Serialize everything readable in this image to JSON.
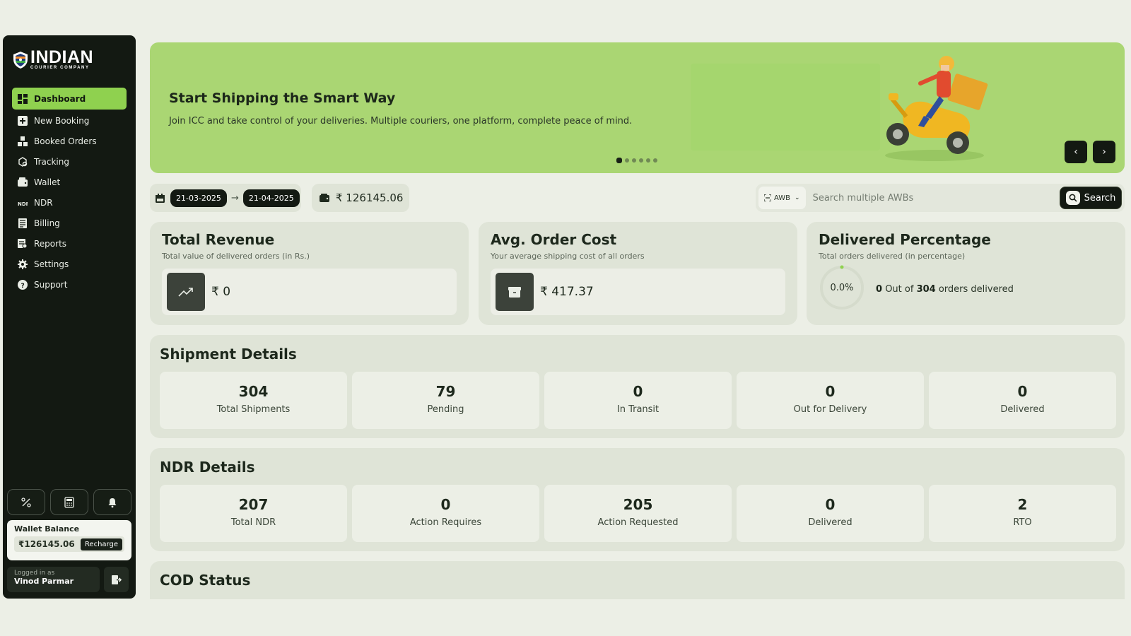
{
  "brand": {
    "name": "INDIAN",
    "tagline": "COURIER COMPANY"
  },
  "sidebar": {
    "items": [
      {
        "label": "Dashboard",
        "icon": "dashboard-icon",
        "active": true
      },
      {
        "label": "New Booking",
        "icon": "plus-square-icon"
      },
      {
        "label": "Booked Orders",
        "icon": "boxes-icon"
      },
      {
        "label": "Tracking",
        "icon": "tracking-icon"
      },
      {
        "label": "Wallet",
        "icon": "wallet-icon"
      },
      {
        "label": "NDR",
        "icon": "ndr-icon"
      },
      {
        "label": "Billing",
        "icon": "billing-icon"
      },
      {
        "label": "Reports",
        "icon": "reports-icon"
      },
      {
        "label": "Settings",
        "icon": "gear-icon"
      },
      {
        "label": "Support",
        "icon": "help-icon"
      }
    ],
    "wallet": {
      "title": "Wallet Balance",
      "amount": "₹126145.06",
      "recharge": "Recharge"
    },
    "user": {
      "label": "Logged in as",
      "name": "Vinod Parmar"
    }
  },
  "banner": {
    "title": "Start Shipping the Smart Way",
    "subtitle": "Join ICC and take control of your deliveries. Multiple couriers, one platform, complete peace of mind.",
    "slide_count": 6,
    "active_slide": 1
  },
  "filters": {
    "date_from": "21-03-2025",
    "date_to": "21-04-2025",
    "balance": "₹ 126145.06"
  },
  "search": {
    "type": "AWB",
    "placeholder": "Search multiple AWBs",
    "button": "Search"
  },
  "stats": {
    "revenue": {
      "title": "Total Revenue",
      "subtitle": "Total value of delivered orders (in Rs.)",
      "value": "₹ 0"
    },
    "avg_cost": {
      "title": "Avg. Order Cost",
      "subtitle": "Your average shipping cost of all orders",
      "value": "₹ 417.37"
    },
    "delivered": {
      "title": "Delivered Percentage",
      "subtitle": "Total orders delivered (in percentage)",
      "percent_label": "0.0%",
      "percent": 0.0,
      "delivered_count": "0",
      "out_of": "Out of",
      "total_count": "304",
      "suffix": "orders delivered"
    }
  },
  "shipment": {
    "title": "Shipment Details",
    "cells": [
      {
        "value": "304",
        "label": "Total Shipments"
      },
      {
        "value": "79",
        "label": "Pending"
      },
      {
        "value": "0",
        "label": "In Transit"
      },
      {
        "value": "0",
        "label": "Out for Delivery"
      },
      {
        "value": "0",
        "label": "Delivered"
      }
    ]
  },
  "ndr": {
    "title": "NDR Details",
    "cells": [
      {
        "value": "207",
        "label": "Total NDR"
      },
      {
        "value": "0",
        "label": "Action Requires"
      },
      {
        "value": "205",
        "label": "Action Requested"
      },
      {
        "value": "0",
        "label": "Delivered"
      },
      {
        "value": "2",
        "label": "RTO"
      }
    ]
  },
  "cod": {
    "title": "COD Status"
  },
  "colors": {
    "accent": "#8fd14f",
    "banner": "#aad673",
    "sidebar": "#131912",
    "panel": "#dfe4d7"
  }
}
